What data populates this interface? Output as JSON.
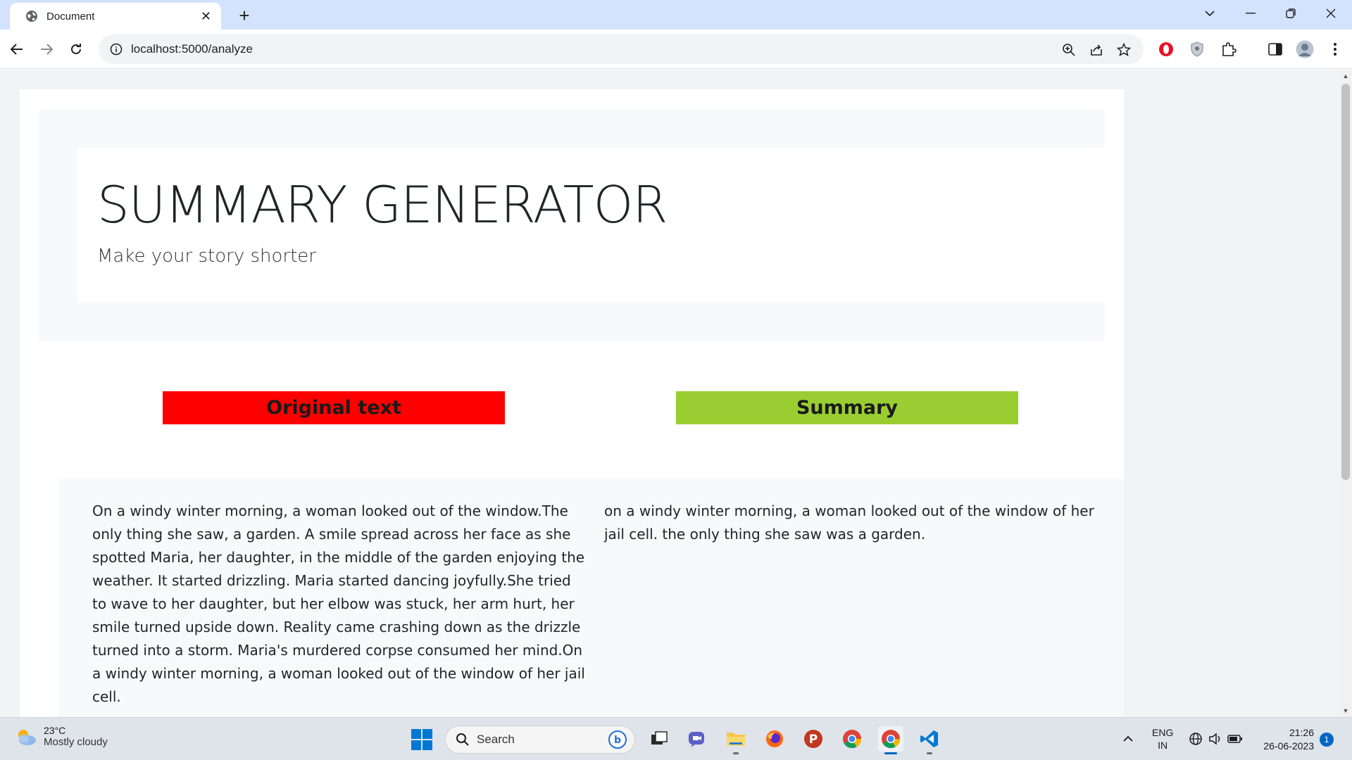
{
  "browser": {
    "tab_title": "Document",
    "url": "localhost:5000/analyze"
  },
  "page": {
    "title": "SUMMARY GENERATOR",
    "subtitle": "Make your story shorter",
    "original_label": "Original text",
    "summary_label": "Summary",
    "original_text": "On a windy winter morning, a woman looked out of the window.The only thing she saw, a garden. A smile spread across her face as she spotted Maria, her daughter, in the middle of the garden enjoying the weather. It started drizzling. Maria started dancing joyfully.She tried to wave to her daughter, but her elbow was stuck, her arm hurt, her smile turned upside down. Reality came crashing down as the drizzle turned into a storm. Maria's murdered corpse consumed her mind.On a windy winter morning, a woman looked out of the window of her jail cell.",
    "summary_text": "on a windy winter morning, a woman looked out of the window of her jail cell. the only thing she saw was a garden."
  },
  "colors": {
    "original_label_bg": "#ff0000",
    "summary_label_bg": "#9acd32"
  },
  "taskbar": {
    "weather_temp": "23°C",
    "weather_condition": "Mostly cloudy",
    "search_label": "Search",
    "lang_line1": "ENG",
    "lang_line2": "IN",
    "time": "21:26",
    "date": "26-06-2023",
    "notification_count": "1"
  }
}
